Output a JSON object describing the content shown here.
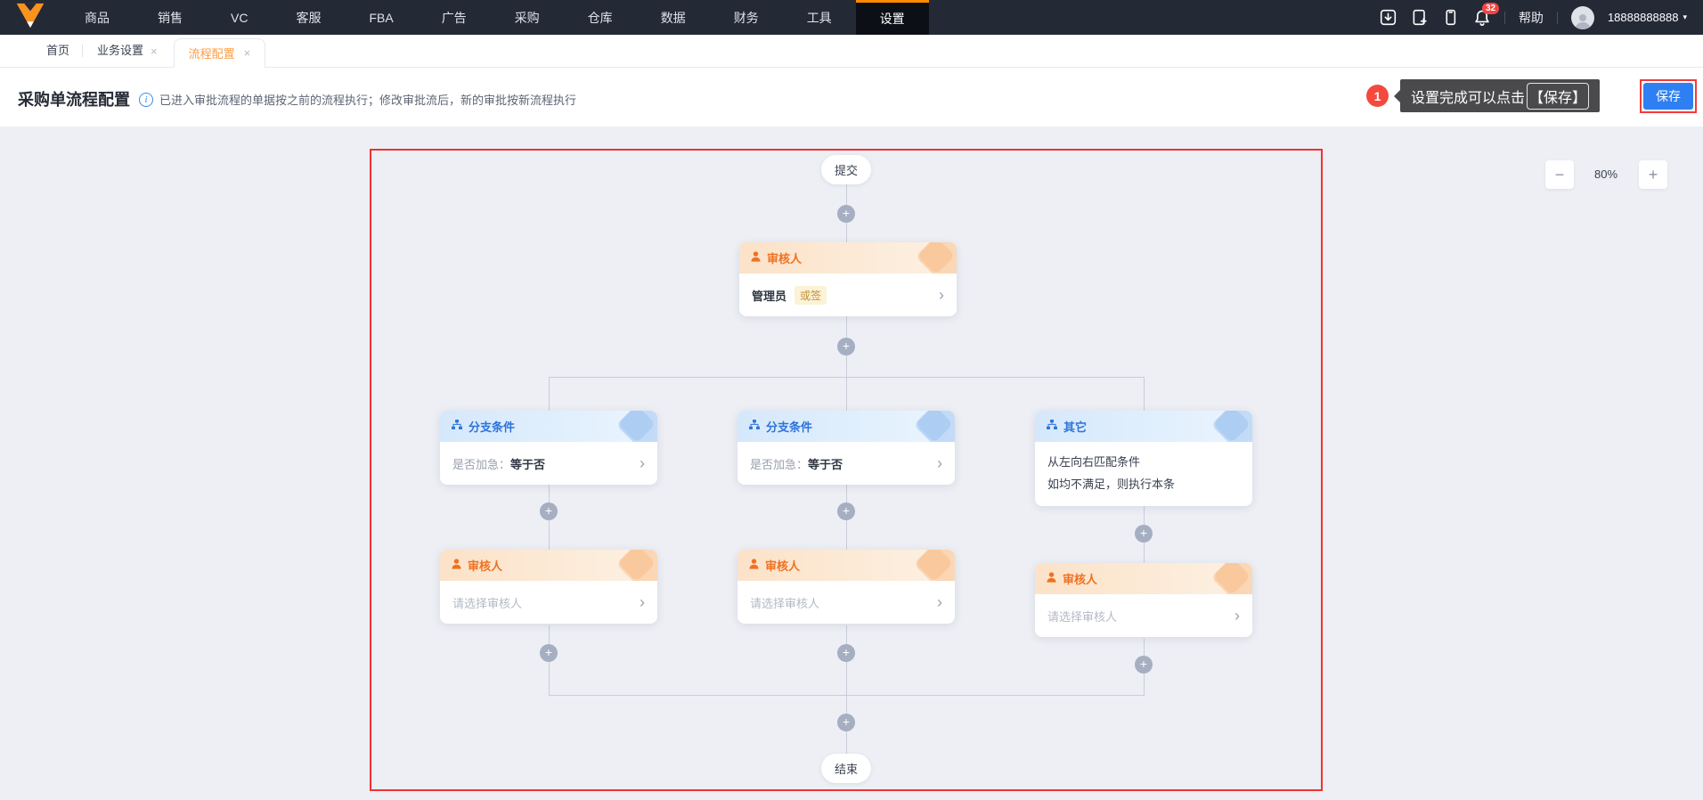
{
  "nav": {
    "items": [
      {
        "label": "商品"
      },
      {
        "label": "销售"
      },
      {
        "label": "VC"
      },
      {
        "label": "客服"
      },
      {
        "label": "FBA"
      },
      {
        "label": "广告"
      },
      {
        "label": "采购"
      },
      {
        "label": "仓库"
      },
      {
        "label": "数据"
      },
      {
        "label": "财务"
      },
      {
        "label": "工具"
      },
      {
        "label": "设置"
      }
    ],
    "active_item": "设置",
    "notification_count": "32",
    "help_label": "帮助",
    "username": "18888888888"
  },
  "tabs": {
    "home_label": "首页",
    "items": [
      {
        "label": "业务设置"
      },
      {
        "label": "流程配置",
        "active": true
      }
    ]
  },
  "page_header": {
    "title": "采购单流程配置",
    "info_text": "已进入审批流程的单据按之前的流程执行；修改审批流后，新的审批按新流程执行",
    "guide_step": "1",
    "tooltip_prefix": "设置完成可以点击",
    "tooltip_highlight": "【保存】",
    "save_label": "保存"
  },
  "zoom_toolbar": {
    "zoom_out": "−",
    "zoom_level": "80%",
    "zoom_in": "+"
  },
  "flow": {
    "start_label": "提交",
    "end_label": "结束",
    "approver_top": {
      "type_label": "审核人",
      "name": "管理员",
      "badge": "或签"
    },
    "branch_left": {
      "type_label": "分支条件",
      "condition_label": "是否加急：",
      "condition_value": "等于否"
    },
    "branch_middle": {
      "type_label": "分支条件",
      "condition_label": "是否加急：",
      "condition_value": "等于否"
    },
    "branch_other": {
      "type_label": "其它",
      "line1": "从左向右匹配条件",
      "line2": "如均不满足，则执行本条"
    },
    "approver_left": {
      "type_label": "审核人",
      "placeholder": "请选择审核人"
    },
    "approver_middle": {
      "type_label": "审核人",
      "placeholder": "请选择审核人"
    },
    "approver_right": {
      "type_label": "审核人",
      "placeholder": "请选择审核人"
    }
  },
  "icons": {
    "plus": "+",
    "chevron": "›",
    "close": "×",
    "caret": "▾",
    "info": "i"
  },
  "colors": {
    "accent_orange": "#ff8a00",
    "header_orange": "#ef7122",
    "header_blue": "#2d74da",
    "guide_red": "#f23c3c",
    "save_blue": "#2e7ff2",
    "nav_bg": "#242936"
  }
}
